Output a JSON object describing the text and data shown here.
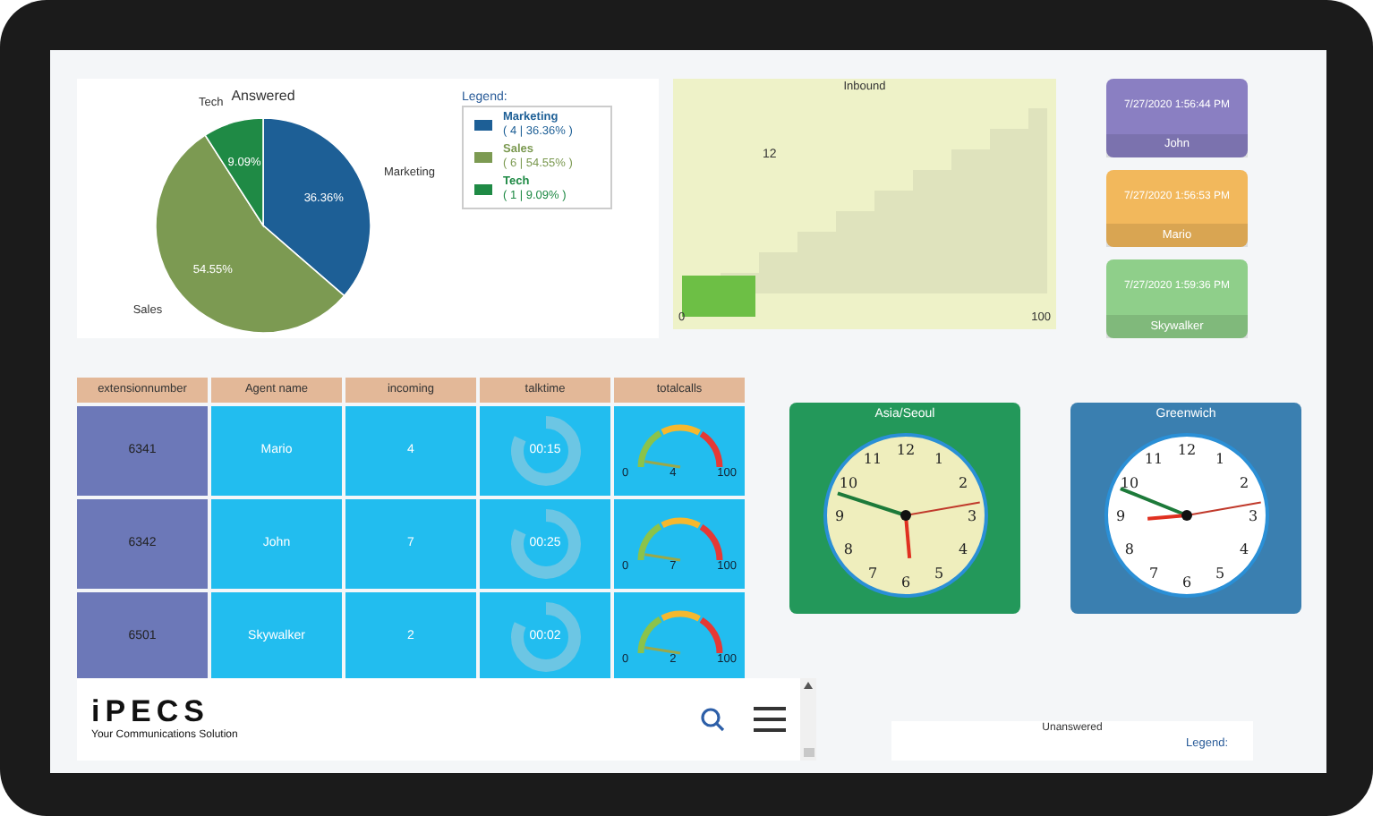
{
  "answered_chart": {
    "chart_data": {
      "type": "pie",
      "title": "Answered",
      "categories": [
        "Marketing",
        "Sales",
        "Tech"
      ],
      "values": [
        36.36,
        54.55,
        9.09
      ],
      "colors": [
        "#1d5f96",
        "#7c9a52",
        "#1f8a45"
      ],
      "value_labels": [
        "36.36%",
        "54.55%",
        "9.09%"
      ]
    },
    "legend": {
      "title": "Legend:",
      "items": [
        {
          "label": "Marketing",
          "detail": "( 4 | 36.36% )",
          "color": "#1d5f96"
        },
        {
          "label": "Sales",
          "detail": "( 6 | 54.55% )",
          "color": "#7c9a52"
        },
        {
          "label": "Tech",
          "detail": "( 1 | 9.09% )",
          "color": "#1f8a45"
        }
      ]
    }
  },
  "inbound": {
    "title": "Inbound",
    "value": "12",
    "min": "0",
    "max": "100",
    "level": 0.2
  },
  "agent_cards": [
    {
      "time": "7/27/2020 1:56:44 PM",
      "name": "John",
      "color": "#8a7fc2"
    },
    {
      "time": "7/27/2020 1:56:53 PM",
      "name": "Mario",
      "color": "#f2b85c"
    },
    {
      "time": "7/27/2020 1:59:36 PM",
      "name": "Skywalker",
      "color": "#8fcf8a"
    }
  ],
  "table": {
    "columns": [
      "extensionnumber",
      "Agent name",
      "incoming",
      "talktime",
      "totalcalls"
    ],
    "rows": [
      {
        "extension": "6341",
        "agent": "Mario",
        "incoming": "4",
        "talktime": {
          "text": "00:15"
        },
        "totalcalls": {
          "min": "0",
          "value": "4",
          "max": "100"
        }
      },
      {
        "extension": "6342",
        "agent": "John",
        "incoming": "7",
        "talktime": {
          "text": "00:25"
        },
        "totalcalls": {
          "min": "0",
          "value": "7",
          "max": "100"
        }
      },
      {
        "extension": "6501",
        "agent": "Skywalker",
        "incoming": "2",
        "talktime": {
          "text": "00:02"
        },
        "totalcalls": {
          "min": "0",
          "value": "2",
          "max": "100"
        }
      }
    ]
  },
  "clocks": [
    {
      "title": "Asia/Seoul",
      "kind": "cream",
      "numbers": [
        "12",
        "1",
        "2",
        "3",
        "4",
        "5",
        "6",
        "7",
        "8",
        "9",
        "10",
        "11"
      ]
    },
    {
      "title": "Greenwich",
      "kind": "white",
      "numbers": [
        "12",
        "1",
        "2",
        "3",
        "4",
        "5",
        "6",
        "7",
        "8",
        "9",
        "10",
        "11"
      ]
    }
  ],
  "header": {
    "logo": "iPECS",
    "tagline": "Your Communications Solution"
  },
  "unanswered": {
    "title": "Unanswered",
    "legend": "Legend:"
  }
}
